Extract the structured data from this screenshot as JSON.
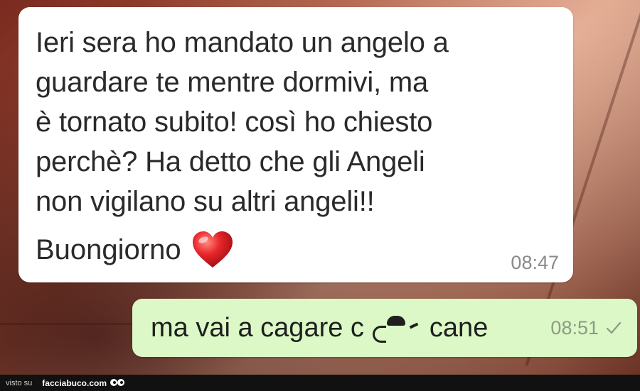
{
  "incoming": {
    "lines": [
      "Ieri sera ho mandato un angelo a",
      "guardare te mentre dormivi, ma",
      "è tornato subito! così ho chiesto",
      "perchè? Ha detto che gli Angeli",
      "non vigilano su altri angeli!!"
    ],
    "greeting": "Buongiorno",
    "emoji": "heart-icon",
    "time": "08:47"
  },
  "outgoing": {
    "text_before": "ma vai a cagare c",
    "text_after": "cane",
    "time": "08:51",
    "status_icon": "single-check-icon"
  },
  "footer": {
    "prefix": "visto su",
    "site": "facciabuco.com"
  },
  "colors": {
    "incoming_bubble": "#ffffff",
    "outgoing_bubble": "#dcf8c6",
    "timestamp": "#8a8a8a",
    "footer_bg": "#111111"
  }
}
